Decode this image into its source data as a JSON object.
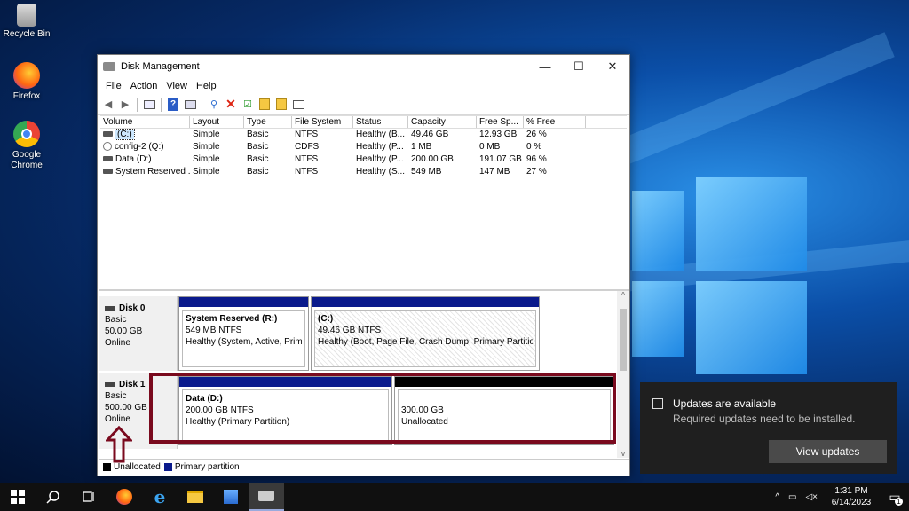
{
  "desktop": {
    "icons": [
      {
        "label": "Recycle Bin"
      },
      {
        "label": "Firefox"
      },
      {
        "label": "Google Chrome"
      }
    ]
  },
  "window": {
    "title": "Disk Management",
    "menu": [
      "File",
      "Action",
      "View",
      "Help"
    ],
    "columns": [
      "Volume",
      "Layout",
      "Type",
      "File System",
      "Status",
      "Capacity",
      "Free Sp...",
      "% Free"
    ],
    "rows": [
      {
        "volume": "(C:)",
        "layout": "Simple",
        "type": "Basic",
        "fs": "NTFS",
        "status": "Healthy (B...",
        "capacity": "49.46 GB",
        "free": "12.93 GB",
        "pct": "26 %"
      },
      {
        "volume": "config-2 (Q:)",
        "layout": "Simple",
        "type": "Basic",
        "fs": "CDFS",
        "status": "Healthy (P...",
        "capacity": "1 MB",
        "free": "0 MB",
        "pct": "0 %"
      },
      {
        "volume": "Data (D:)",
        "layout": "Simple",
        "type": "Basic",
        "fs": "NTFS",
        "status": "Healthy (P...",
        "capacity": "200.00 GB",
        "free": "191.07 GB",
        "pct": "96 %"
      },
      {
        "volume": "System Reserved ...",
        "layout": "Simple",
        "type": "Basic",
        "fs": "NTFS",
        "status": "Healthy (S...",
        "capacity": "549 MB",
        "free": "147 MB",
        "pct": "27 %"
      }
    ],
    "disks": [
      {
        "name": "Disk 0",
        "type": "Basic",
        "size": "50.00 GB",
        "state": "Online",
        "partitions": [
          {
            "title": "System Reserved  (R:)",
            "size": "549 MB NTFS",
            "status": "Healthy (System, Active, Primary"
          },
          {
            "title": "(C:)",
            "size": "49.46 GB NTFS",
            "status": "Healthy (Boot, Page File, Crash Dump, Primary Partition)"
          }
        ]
      },
      {
        "name": "Disk 1",
        "type": "Basic",
        "size": "500.00 GB",
        "state": "Online",
        "partitions": [
          {
            "title": "Data  (D:)",
            "size": "200.00 GB NTFS",
            "status": "Healthy (Primary Partition)"
          },
          {
            "title": "",
            "size": "300.00 GB",
            "status": "Unallocated"
          }
        ]
      }
    ],
    "legend": {
      "unallocated": "Unallocated",
      "primary": "Primary partition"
    },
    "colors": {
      "primary": "#0a1a8c",
      "unallocated": "#000000",
      "highlight": "#7a0a1e"
    }
  },
  "toast": {
    "title": "Updates are available",
    "body": "Required updates need to be installed.",
    "button": "View updates"
  },
  "taskbar": {
    "time": "1:31 PM",
    "date": "6/14/2023",
    "notification_count": "1"
  }
}
